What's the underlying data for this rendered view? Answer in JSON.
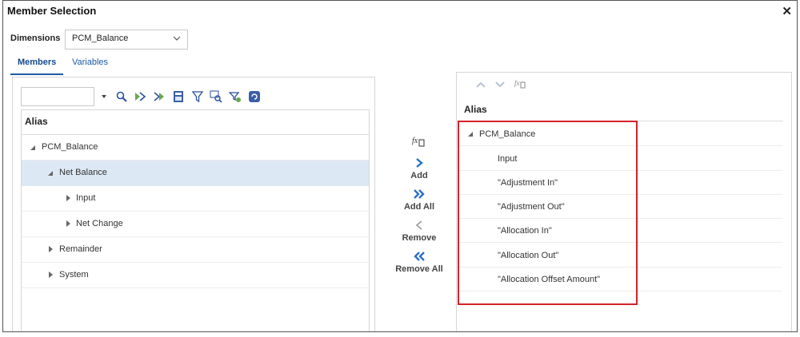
{
  "dialog": {
    "title": "Member Selection",
    "close_glyph": "✕"
  },
  "dimensions": {
    "label": "Dimensions",
    "selected": "PCM_Balance"
  },
  "tabs": [
    {
      "label": "Members",
      "active": true
    },
    {
      "label": "Variables",
      "active": false
    }
  ],
  "left": {
    "search_value": "",
    "toolbar_icons": [
      "search-icon",
      "expand-icon",
      "collapse-icon",
      "calculator-icon",
      "filter-icon",
      "find-icon",
      "advanced-filter-icon",
      "refresh-icon"
    ],
    "column_header": "Alias",
    "tree": [
      {
        "label": "PCM_Balance",
        "state": "expanded",
        "level": 0,
        "selected": false
      },
      {
        "label": "Net Balance",
        "state": "expanded",
        "level": 1,
        "selected": true
      },
      {
        "label": "Input",
        "state": "collapsed",
        "level": 2,
        "selected": false
      },
      {
        "label": "Net Change",
        "state": "collapsed",
        "level": 2,
        "selected": false
      },
      {
        "label": "Remainder",
        "state": "collapsed",
        "level": 1,
        "selected": false
      },
      {
        "label": "System",
        "state": "collapsed",
        "level": 1,
        "selected": false
      }
    ]
  },
  "actions": {
    "add": "Add",
    "add_all": "Add All",
    "remove": "Remove",
    "remove_all": "Remove All"
  },
  "right": {
    "column_header": "Alias",
    "rows": [
      {
        "label": "PCM_Balance",
        "expanded": true
      },
      {
        "label": "Input"
      },
      {
        "label": "\"Adjustment In\""
      },
      {
        "label": "\"Adjustment Out\""
      },
      {
        "label": "\"Allocation In\""
      },
      {
        "label": "\"Allocation Out\""
      },
      {
        "label": "\"Allocation Offset Amount\""
      }
    ]
  },
  "colors": {
    "accent": "#1d5aa7",
    "selection": "#dde8f5",
    "highlight_border": "#d3222a"
  }
}
